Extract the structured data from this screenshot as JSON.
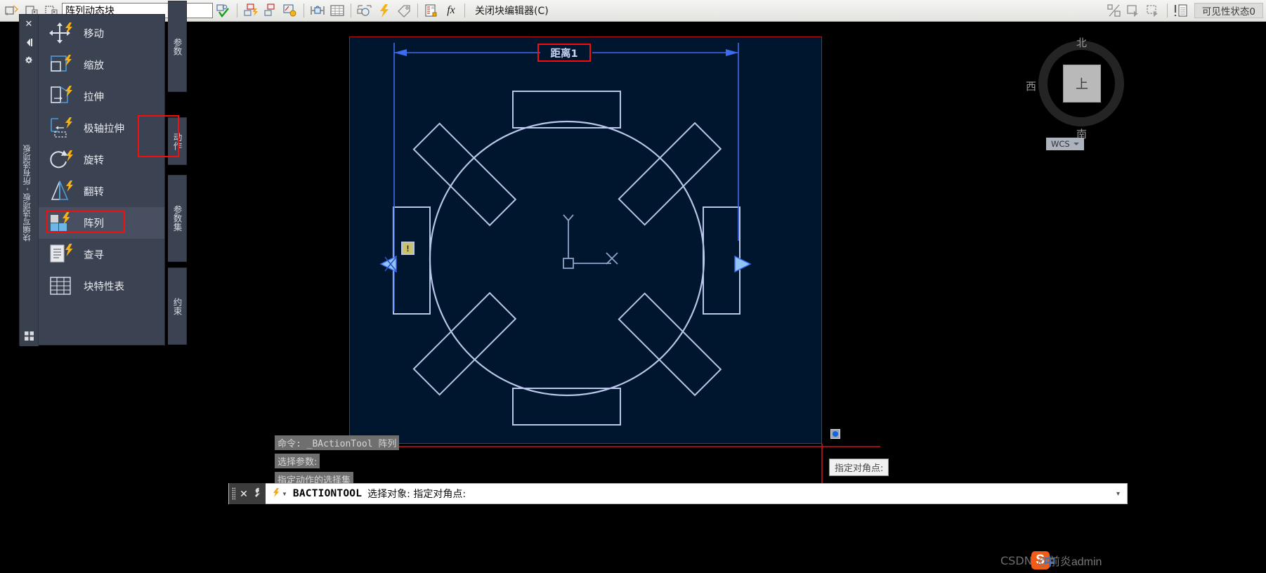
{
  "toolbar": {
    "block_name_value": "阵列动态块",
    "block_name_placeholder": "",
    "left_icons": [
      {
        "name": "edit-block-definition-icon",
        "glyph": "✎"
      },
      {
        "name": "save-block-icon",
        "glyph": "▤"
      },
      {
        "name": "save-block-as-icon",
        "glyph": "▥"
      }
    ],
    "mid_icons": [
      {
        "name": "test-block-icon",
        "glyph": "✓"
      },
      {
        "name": "auto-constrain-icon",
        "glyph": "⚡"
      },
      {
        "name": "constraint-display-icon",
        "glyph": "◱"
      },
      {
        "name": "constraint-settings-icon",
        "glyph": "◐"
      },
      {
        "name": "block-table-lock-icon",
        "glyph": "🔒"
      },
      {
        "name": "parameter-manager-icon",
        "glyph": "▦"
      },
      {
        "name": "parameters-table-icon",
        "glyph": "⊞"
      },
      {
        "name": "attribute-definition-icon",
        "glyph": "⊡"
      },
      {
        "name": "action-lightning-icon",
        "glyph": "⚡"
      },
      {
        "name": "block-tag-icon",
        "glyph": "🏷"
      },
      {
        "name": "block-properties-table-icon",
        "glyph": "▤"
      },
      {
        "name": "function-fx-icon",
        "glyph": "fx"
      }
    ],
    "close_editor_label": "关闭块编辑器(C)",
    "right_icons": [
      {
        "name": "visibility-mode-icon",
        "glyph": "%"
      },
      {
        "name": "make-visible-icon",
        "glyph": "▭"
      },
      {
        "name": "make-invisible-icon",
        "glyph": "▱"
      },
      {
        "name": "visibility-states-icon",
        "glyph": "❗"
      }
    ],
    "visibility_state_value": "可见性状态0"
  },
  "palette": {
    "vertical_title": "块编写选项板 - 所有选项板",
    "close_label": "✕",
    "autohide_label": "◀|",
    "properties_label": "✦",
    "grid_label": "▦",
    "items": [
      {
        "label": "移动",
        "icon": "move-action-icon"
      },
      {
        "label": "缩放",
        "icon": "scale-action-icon"
      },
      {
        "label": "拉伸",
        "icon": "stretch-action-icon"
      },
      {
        "label": "极轴拉伸",
        "icon": "polar-stretch-action-icon"
      },
      {
        "label": "旋转",
        "icon": "rotate-action-icon"
      },
      {
        "label": "翻转",
        "icon": "flip-action-icon"
      },
      {
        "label": "阵列",
        "icon": "array-action-icon",
        "selected": true
      },
      {
        "label": "查寻",
        "icon": "lookup-action-icon"
      },
      {
        "label": "块特性表",
        "icon": "block-properties-table-icon"
      }
    ],
    "tabs": [
      {
        "label": "参数",
        "name": "tab-parameters"
      },
      {
        "label": "动作",
        "name": "tab-actions",
        "active": true
      },
      {
        "label": "参数集",
        "name": "tab-parameter-sets"
      },
      {
        "label": "约束",
        "name": "tab-constraints"
      }
    ]
  },
  "canvas": {
    "dimension_label": "距离1",
    "warning_badge": "!",
    "ucs_x_label": "X",
    "ucs_y_label": "Y"
  },
  "command_history": [
    "命令: _BActionTool 阵列",
    "选择参数:",
    "指定动作的选择集"
  ],
  "tooltip": {
    "text": "指定对角点:"
  },
  "command_bar": {
    "command_name": "BACTIONTOOL",
    "prompt": "选择对象: 指定对角点:",
    "close_label": "✕",
    "settings_label": "🔧",
    "expand_label": "▾"
  },
  "viewcube": {
    "north": "北",
    "south": "南",
    "west": "西",
    "top": "上",
    "wcs_label": "WCS"
  },
  "watermark": {
    "prefix": "CSDN",
    "suffix": "@前炎admin"
  },
  "colors": {
    "highlight_red": "#f60d0d",
    "canvas_bg": "#00152e",
    "palette_bg": "#3b4353",
    "accent_blue": "#3c6cf0",
    "geometry": "#b8c7e8"
  }
}
